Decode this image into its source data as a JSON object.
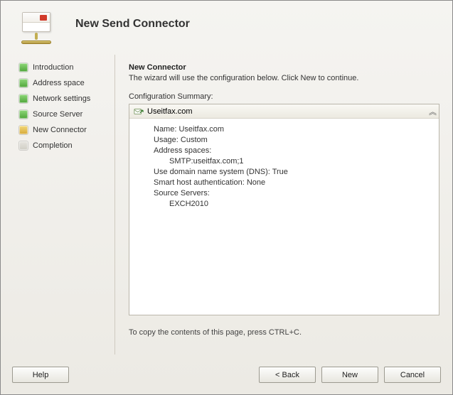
{
  "header": {
    "title": "New Send Connector"
  },
  "steps": [
    {
      "label": "Introduction",
      "state": "done"
    },
    {
      "label": "Address space",
      "state": "done"
    },
    {
      "label": "Network settings",
      "state": "done"
    },
    {
      "label": "Source Server",
      "state": "done"
    },
    {
      "label": "New Connector",
      "state": "active"
    },
    {
      "label": "Completion",
      "state": "pending"
    }
  ],
  "main": {
    "title": "New Connector",
    "description": "The wizard will use the configuration below.  Click New to continue.",
    "summary_label": "Configuration Summary:",
    "copy_hint": "To copy the contents of this page, press CTRL+C."
  },
  "summary": {
    "connector_name": "Useitfax.com",
    "details": {
      "name_label": "Name:",
      "name_value": "Useitfax.com",
      "usage_label": "Usage:",
      "usage_value": "Custom",
      "address_spaces_label": "Address spaces:",
      "address_spaces_value": "SMTP:useitfax.com;1",
      "dns_label": "Use domain name system (DNS):",
      "dns_value": "True",
      "smart_host_label": "Smart host authentication:",
      "smart_host_value": "None",
      "source_servers_label": "Source Servers:",
      "source_servers_value": "EXCH2010"
    }
  },
  "buttons": {
    "help": "Help",
    "back": "< Back",
    "next": "New",
    "cancel": "Cancel"
  }
}
